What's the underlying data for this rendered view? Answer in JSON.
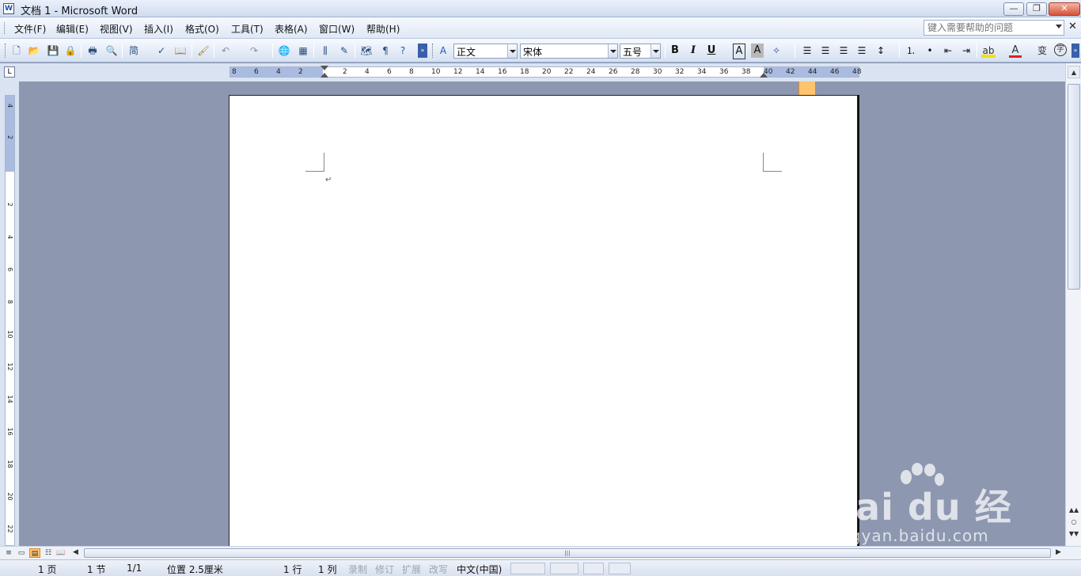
{
  "window": {
    "title": "文档 1 - Microsoft Word",
    "app_icon_letter": "W",
    "controls": {
      "minimize": "—",
      "restore": "❐",
      "close": "✕"
    }
  },
  "menu": {
    "items": [
      "文件(F)",
      "编辑(E)",
      "视图(V)",
      "插入(I)",
      "格式(O)",
      "工具(T)",
      "表格(A)",
      "窗口(W)",
      "帮助(H)"
    ],
    "help_placeholder": "键入需要帮助的问题",
    "doc_close": "✕"
  },
  "toolbar": {
    "style_value": "正文",
    "font_value": "宋体",
    "size_value": "五号",
    "bold": "B",
    "italic": "I",
    "underline": "U",
    "char_border": "A",
    "char_shading": "A",
    "font_color": "A",
    "colors": {
      "font_color_underline": "#e02020",
      "highlight": "#f3e100",
      "active_button": "#ffc36e"
    }
  },
  "ruler": {
    "horizontal_labels": [
      "8",
      "6",
      "4",
      "2",
      "2",
      "4",
      "6",
      "8",
      "10",
      "12",
      "14",
      "16",
      "18",
      "20",
      "22",
      "24",
      "26",
      "28",
      "30",
      "32",
      "34",
      "36",
      "38",
      "40",
      "42",
      "44",
      "46",
      "48"
    ],
    "vertical_labels": [
      "4",
      "2",
      "2",
      "4",
      "6",
      "8",
      "10",
      "12",
      "14",
      "16",
      "18",
      "20",
      "22"
    ],
    "tab_selector": "L"
  },
  "document": {
    "paragraph_mark": "↵"
  },
  "statusbar": {
    "page": "1 页",
    "section": "1 节",
    "page_of": "1/1",
    "position": "位置 2.5厘米",
    "line": "1 行",
    "column": "1 列",
    "rec": "录制",
    "trk": "修订",
    "ext": "扩展",
    "ovr": "改写",
    "language": "中文(中国)"
  },
  "watermark": {
    "brand": "Bai du 经验",
    "url": "jingyan.baidu.com"
  }
}
